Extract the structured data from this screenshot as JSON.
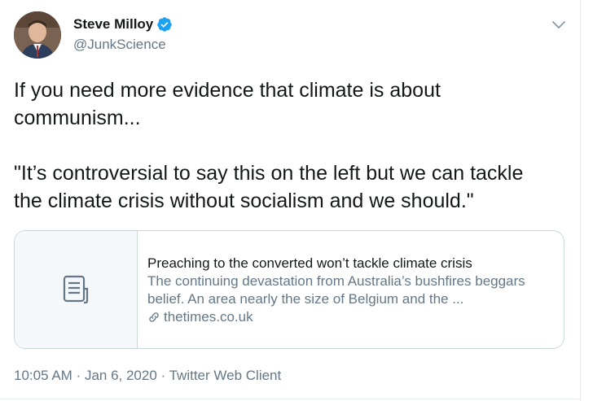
{
  "author": {
    "name": "Steve Milloy",
    "handle": "@JunkScience",
    "verified": true
  },
  "tweet": {
    "text": "If you need more evidence that climate is about\ncommunism...\n\n\"It’s controversial to say this on the left but we can tackle\nthe climate crisis without socialism and we should.\""
  },
  "card": {
    "icon": "document-icon",
    "title": "Preaching to the converted won’t tackle climate crisis",
    "description": "The continuing devastation from Australia’s bushfires beggars belief. An area nearly the size of Belgium and the ...",
    "domain": "thetimes.co.uk"
  },
  "meta": {
    "time": "10:05 AM",
    "separator1": " · ",
    "date": "Jan 6, 2020",
    "separator2": " · ",
    "source": "Twitter Web Client"
  },
  "colors": {
    "verified_blue": "#1da1f2",
    "secondary_text": "#657786",
    "border": "#ccd6dd"
  }
}
